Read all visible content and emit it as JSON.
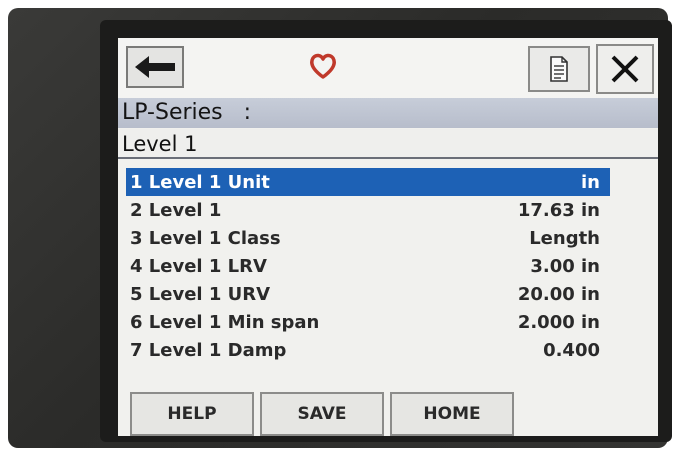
{
  "header": {
    "device_title": "LP-Series   :",
    "screen_title": "Level 1"
  },
  "toolbar": {
    "back_icon": "arrow-left-icon",
    "status_icon": "heart-icon",
    "doc_icon": "document-icon",
    "close_icon": "close-icon",
    "status_color": "#c0392b"
  },
  "menu": {
    "items": [
      {
        "label": "1 Level 1 Unit",
        "value": "in",
        "selected": true
      },
      {
        "label": "2 Level 1",
        "value": "17.63 in"
      },
      {
        "label": "3 Level 1 Class",
        "value": "Length"
      },
      {
        "label": "4 Level 1 LRV",
        "value": "3.00 in"
      },
      {
        "label": "5 Level 1 URV",
        "value": "20.00 in"
      },
      {
        "label": "6 Level 1 Min span",
        "value": "2.000 in"
      },
      {
        "label": "7 Level 1 Damp",
        "value": "0.400"
      }
    ],
    "selection_color": "#1d61b5"
  },
  "softkeys": {
    "help": "HELP",
    "save": "SAVE",
    "home": "HOME"
  }
}
